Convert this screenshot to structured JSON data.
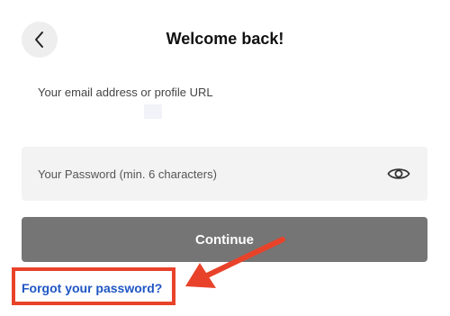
{
  "header": {
    "title": "Welcome back!",
    "back_icon": "chevron-left-icon"
  },
  "form": {
    "email_label": "Your email address or profile URL",
    "email_value": "",
    "password_placeholder": "Your Password (min. 6 characters)",
    "password_value": "",
    "show_password_icon": "eye-icon",
    "continue_label": "Continue",
    "forgot_label": "Forgot your password?"
  },
  "colors": {
    "continue_button": "#757575",
    "link": "#1f56c4",
    "annotation": "#e8432a"
  }
}
